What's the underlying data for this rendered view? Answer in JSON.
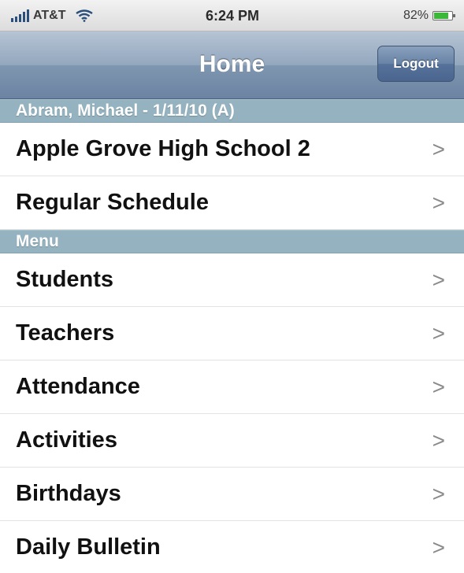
{
  "status_bar": {
    "carrier": "AT&T",
    "time": "6:24 PM",
    "battery_percent": "82%",
    "battery_level": 0.82,
    "icons": [
      "signal-icon",
      "wifi-icon",
      "battery-icon"
    ]
  },
  "nav": {
    "title": "Home",
    "logout_label": "Logout"
  },
  "sections": [
    {
      "header": "Abram, Michael - 1/11/10 (A)",
      "items": [
        {
          "label": "Apple Grove High School 2"
        },
        {
          "label": "Regular Schedule"
        }
      ]
    },
    {
      "header": "Menu",
      "items": [
        {
          "label": "Students"
        },
        {
          "label": "Teachers"
        },
        {
          "label": "Attendance"
        },
        {
          "label": "Activities"
        },
        {
          "label": "Birthdays"
        },
        {
          "label": "Daily Bulletin"
        }
      ]
    }
  ],
  "chevron_glyph": ">",
  "colors": {
    "nav_bar": "#7f96b0",
    "section_header": "#94b2bf",
    "logout_button": "#5a749a",
    "battery_fill": "#3bb838"
  }
}
